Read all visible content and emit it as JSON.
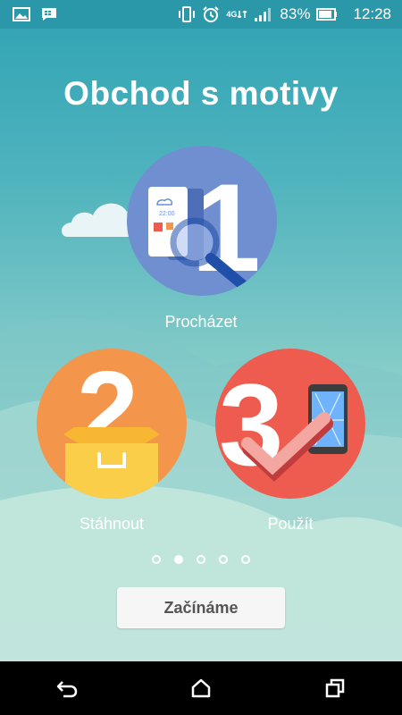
{
  "status_bar": {
    "battery_percent": "83%",
    "time": "12:28",
    "network": "4G",
    "icons": [
      "image-notification-icon",
      "chat-notification-icon",
      "vibrate-icon",
      "alarm-icon",
      "signal-icon",
      "battery-icon"
    ]
  },
  "title": "Obchod s motivy",
  "steps": [
    {
      "number": "1",
      "label": "Procházet",
      "color": "#6f8fd0"
    },
    {
      "number": "2",
      "label": "Stáhnout",
      "color": "#f3964b"
    },
    {
      "number": "3",
      "label": "Použít",
      "color": "#ee5b4f"
    }
  ],
  "illustration_clock": "22:00",
  "pagination": {
    "total": 5,
    "active_index": 1
  },
  "start_button": "Začínáme",
  "nav": [
    "back-icon",
    "home-icon",
    "recent-apps-icon"
  ]
}
